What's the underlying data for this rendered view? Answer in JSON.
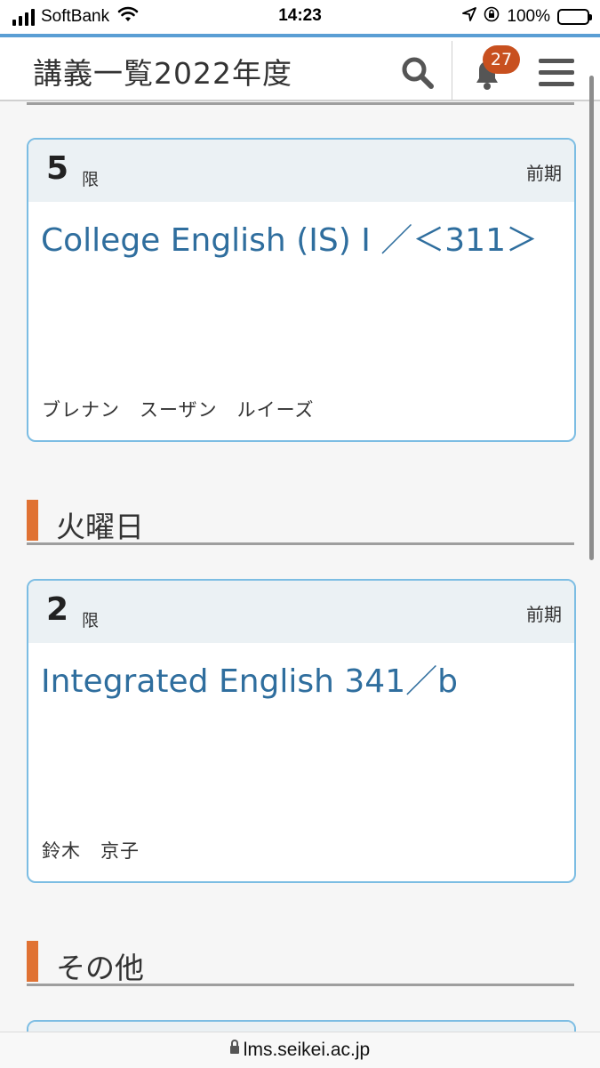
{
  "status_bar": {
    "carrier": "SoftBank",
    "time": "14:23",
    "battery": "100%",
    "icons": [
      "signal-icon",
      "wifi-icon",
      "location-icon",
      "rotation-lock-icon",
      "battery-icon"
    ]
  },
  "header": {
    "title": "講義一覧2022年度",
    "notification_count": "27",
    "accent_color": "#5a9ed4",
    "badge_color": "#c8501f",
    "icons": [
      "search-icon",
      "bell-icon",
      "menu-icon"
    ]
  },
  "courses": [
    {
      "period": "5",
      "period_unit": "限",
      "term": "前期",
      "name": "College English (IS) I ／＜311＞",
      "instructor": "ブレナン　スーザン　ルイーズ"
    },
    {
      "period": "2",
      "period_unit": "限",
      "term": "前期",
      "name": "Integrated English 341／b",
      "instructor": "鈴木　京子"
    }
  ],
  "days": [
    {
      "label": "火曜日"
    },
    {
      "label": "その他"
    }
  ],
  "colors": {
    "day_marker": "#e07233",
    "course_link": "#2f6e9e",
    "card_border": "#7cbde3"
  },
  "browser": {
    "url": "lms.seikei.ac.jp"
  }
}
